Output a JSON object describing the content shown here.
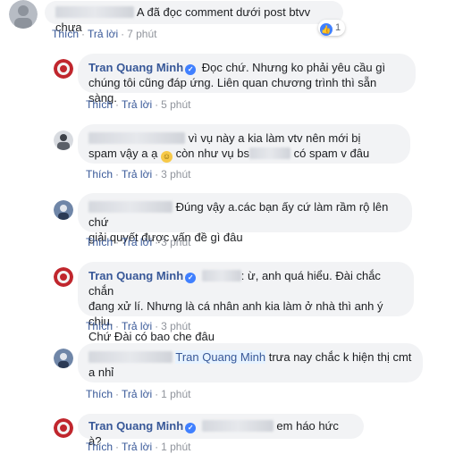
{
  "actions": {
    "like": "Thích",
    "reply": "Trả lời"
  },
  "colors": {
    "link": "#385898",
    "bubble": "#f2f3f5",
    "verified": "#4080ff",
    "meta": "#90949c"
  },
  "icons": {
    "verified": "verified-badge-icon",
    "like": "like-reaction-icon",
    "smile": "smile-emoji-icon"
  },
  "comments": [
    {
      "text": "A đã đọc comment dưới post btvv chưa",
      "time": "7 phút",
      "reaction_count": "1"
    },
    {
      "author": "Tran Quang Minh",
      "text_line1": "Đọc chứ. Nhưng ko phải yêu cầu gì",
      "text_line2": "chúng tôi cũng đáp ứng. Liên quan chương trình thì sẵn sàng.",
      "time": "5 phút"
    },
    {
      "text_line1": "vì vụ này a kia làm vtv nên mới bị",
      "text_line2a": "spam vậy a ạ",
      "text_line2b": "còn như vụ bs",
      "text_line2c": "có spam v đâu",
      "time": "3 phút"
    },
    {
      "text_line1": "Đúng vậy a.các bạn ấy cứ làm rầm rộ lên chứ",
      "text_line2": "giải quyết được vấn đề gì đâu",
      "time": "3 phút"
    },
    {
      "author": "Tran Quang Minh",
      "text_line1": ": ừ, anh quá hiểu. Đài chắc chắn",
      "text_line2": "đang xử lí. Nhưng là cá nhân anh kia làm ở nhà thì anh ý chịu.",
      "text_line3": "Chứ Đài có bao che đâu",
      "time": "3 phút"
    },
    {
      "mention": "Tran Quang Minh",
      "text_line1": "trưa nay chắc k hiện thị cmt",
      "text_line2": "a nhỉ",
      "time": "1 phút"
    },
    {
      "author": "Tran Quang Minh",
      "text": "em háo hức à?",
      "time": "1 phút"
    }
  ]
}
